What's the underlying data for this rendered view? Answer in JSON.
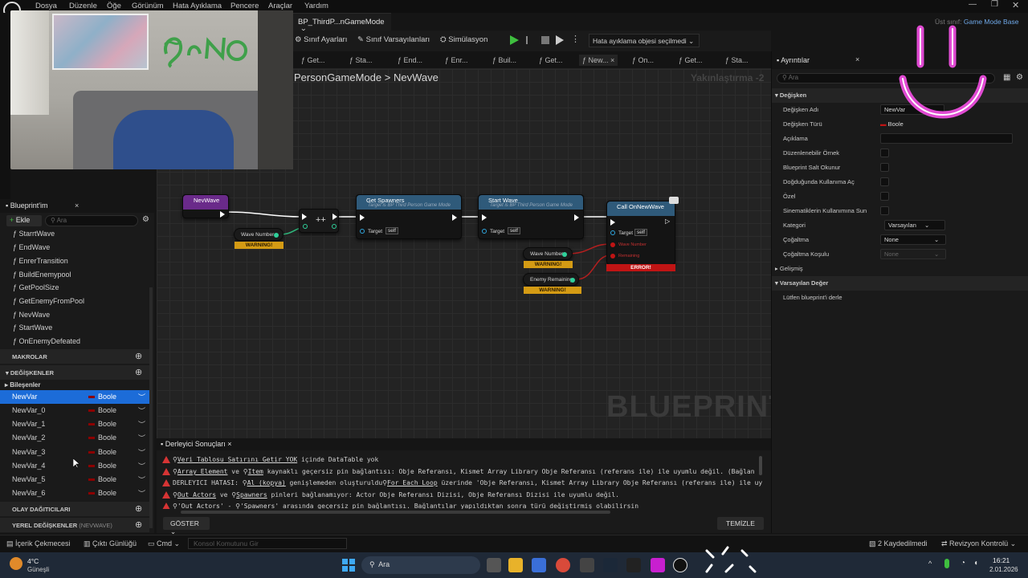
{
  "menu": [
    "Dosya",
    "Düzenle",
    "Öğe",
    "Görünüm",
    "Hata Ayıklama",
    "Pencere",
    "Araçlar",
    "Yardım"
  ],
  "top_right": {
    "parent_label": "Üst sınıf:",
    "parent_class": "Game Mode Base"
  },
  "doc_tab": {
    "title": "BP_ThirdP...nGameMode",
    "close": "×"
  },
  "toolbar": {
    "class_settings": "Sınıf Ayarları",
    "class_defaults": "Sınıf Varsayılanları",
    "simulation": "Simülasyon",
    "debug_object": "Hata ayıklama objesi seçilmedi"
  },
  "fn_tabs": [
    "Get...",
    "Sta...",
    "End...",
    "Enr...",
    "Buil...",
    "Get...",
    "New...",
    "On...",
    "Get...",
    "Sta..."
  ],
  "breadcrumb": {
    "parent": "PersonGameMode",
    "separator": ">",
    "current": "NevWave",
    "zoom": "Yakınlaştırma -2"
  },
  "graph": {
    "watermark": "BLUEPRINT",
    "nodes": {
      "event": {
        "title": "NevWave"
      },
      "wave_var": {
        "label": "Wave Number",
        "warning": "WARNING!"
      },
      "get_spawners": {
        "title": "Get Spawners",
        "sub": "Target is BP Third Person Game Mode",
        "pin": "Target",
        "self": "self"
      },
      "start_wave": {
        "title": "Start Wave",
        "sub": "Target is BP Third Person Game Mode",
        "pin": "Target",
        "self": "self"
      },
      "call_new_wave": {
        "title": "Call OnNewWave",
        "pin": "Target",
        "self": "self",
        "pin2": "Wave Number",
        "pin3": "Remaining",
        "error": "ERROR!"
      },
      "wave_var2": {
        "label": "Wave Number",
        "warning": "WARNING!"
      },
      "enemy_var": {
        "label": "Enemy Remaining",
        "warning": "WARNING!"
      }
    }
  },
  "bp_panel": {
    "tab": "Blueprint'im",
    "close": "×",
    "add": "Ekle",
    "search_placeholder": "Ara",
    "functions": [
      "StarrtWave",
      "EndWave",
      "EnrerTransition",
      "BuildEnemypool",
      "GetPoolSize",
      "GetEnemyFromPool",
      "NevWave",
      "StartWave",
      "OnEnemyDefeated"
    ],
    "sections": {
      "macros": "MAKROLAR",
      "variables": "DEĞİŞKENLER",
      "components": "Bileşenler",
      "dispatchers": "OLAY DAĞITICILARI",
      "locals": "YEREL DEĞİŞKENLER",
      "locals_ctx": "(NEVWAVE)"
    },
    "variables": [
      {
        "name": "NewVar",
        "type": "Boole"
      },
      {
        "name": "NewVar_0",
        "type": "Boole"
      },
      {
        "name": "NewVar_1",
        "type": "Boole"
      },
      {
        "name": "NewVar_2",
        "type": "Boole"
      },
      {
        "name": "NewVar_3",
        "type": "Boole"
      },
      {
        "name": "NewVar_4",
        "type": "Boole"
      },
      {
        "name": "NewVar_5",
        "type": "Boole"
      },
      {
        "name": "NewVar_6",
        "type": "Boole"
      }
    ]
  },
  "details": {
    "tab": "Ayrıntılar",
    "close": "×",
    "search_placeholder": "Ara",
    "section_var": "Değişken",
    "rows": {
      "name_label": "Değişken Adı",
      "name_value": "NewVar",
      "type_label": "Değişken Türü",
      "type_value": "Boole",
      "desc_label": "Açıklama",
      "editable_label": "Düzenlenebilir Örnek",
      "readonly_label": "Blueprint Salt Okunur",
      "spawn_label": "Doğduğunda Kullanıma Aç",
      "private_label": "Özel",
      "cine_label": "Sinematiklerin Kullanımına Sun",
      "category_label": "Kategori",
      "category_value": "Varsayılan",
      "replication_label": "Çoğaltma",
      "replication_value": "None",
      "repcond_label": "Çoğaltma Koşulu",
      "repcond_value": "None"
    },
    "section_adv": "Gelişmiş",
    "section_default": "Varsayılan Değer",
    "compile_hint": "Lütfen blueprint'i derle"
  },
  "compiler": {
    "tab": "Derleyici Sonuçları",
    "close": "×",
    "lines": [
      {
        "a": "Veri Tablosu Satırını Getir YOK",
        "b": " içinde DataTable yok"
      },
      {
        "a": "Array Element",
        "b": " ve ",
        "c": "Item",
        "d": " kaynaklı geçersiz pin bağlantısı: Obje Referansı, Kismet Array Library Obje Referansı (referans ile) ile uyumlu değil. (Bağlan"
      },
      {
        "pre": "DERLEYICI HATASI: ",
        "a": "Al (kopya)",
        "b": " genişlemeden oluşturuldu",
        "c": "For Each Loop",
        "d": " üzerinde 'Obje Referansı, Kismet Array Library Obje Referansı (referans ile) ile uy"
      },
      {
        "a": "Out Actors",
        "b": " ve ",
        "c": "Spawners",
        "d": " pinleri bağlanamıyor: Actor Obje Referansı Dizisi, Obje Referansı Dizisi ile uyumlu değil."
      },
      {
        "a": "'Out Actors'",
        "b": " - ",
        "c": "'Spawners'",
        "d": " arasında geçersiz pin bağlantısı. Bağlantılar yapıldıktan sonra türü değiştirmiş olabilirsin"
      }
    ],
    "show": "GÖSTER",
    "clear": "TEMİZLE"
  },
  "statusbar": {
    "content_drawer": "İçerik Çekmecesi",
    "output_log": "Çıktı Günlüğü",
    "cmd": "Cmd",
    "console_placeholder": "Konsol Komutunu Gir",
    "saved": "2 Kaydedilmedi",
    "revision": "Revizyon Kontrolü"
  },
  "taskbar": {
    "temp": "4°C",
    "weather": "Güneşli",
    "search": "Ara",
    "time": "16:21",
    "date": "2.01.2026"
  },
  "colors": {
    "accent": "#1c6cd8",
    "warning": "#d49b14",
    "error": "#c01414",
    "node_blue": "#2f5a7a",
    "event_purple": "#6a2a8a",
    "bool_red": "#8b0000"
  }
}
